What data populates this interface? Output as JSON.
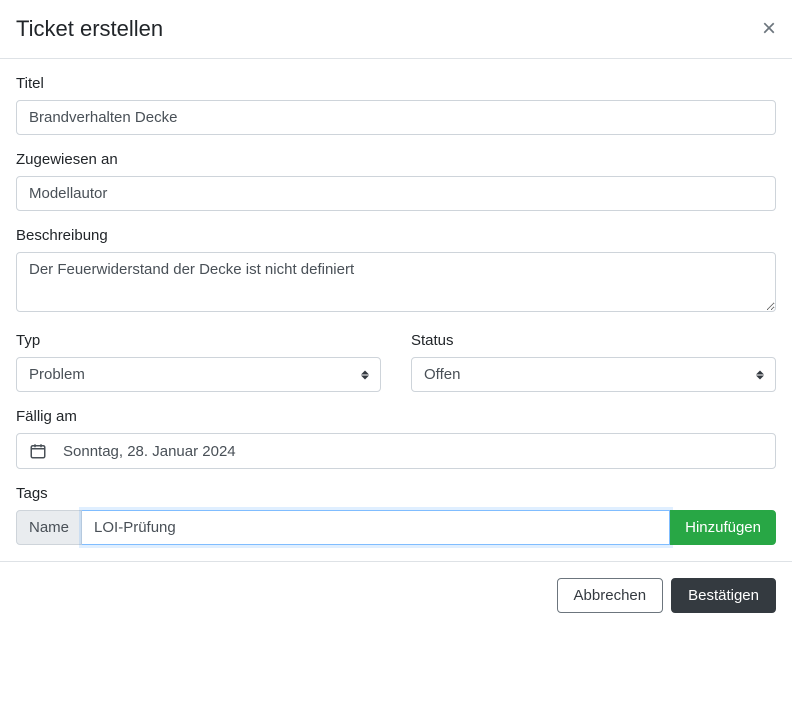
{
  "header": {
    "title": "Ticket erstellen"
  },
  "form": {
    "title_label": "Titel",
    "title_value": "Brandverhalten Decke",
    "assigned_label": "Zugewiesen an",
    "assigned_value": "Modellautor",
    "description_label": "Beschreibung",
    "description_value": "Der Feuerwiderstand der Decke ist nicht definiert",
    "type_label": "Typ",
    "type_value": "Problem",
    "status_label": "Status",
    "status_value": "Offen",
    "due_label": "Fällig am",
    "due_value": "Sonntag, 28. Januar 2024",
    "tags_label": "Tags",
    "tags_name_label": "Name",
    "tags_value": "LOI-Prüfung",
    "add_button": "Hinzufügen"
  },
  "footer": {
    "cancel": "Abbrechen",
    "confirm": "Bestätigen"
  }
}
